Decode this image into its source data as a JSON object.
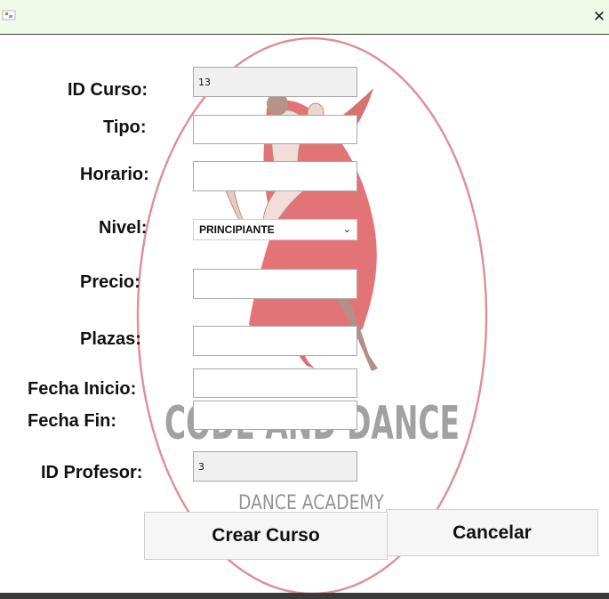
{
  "window": {
    "close_glyph": "✕"
  },
  "form": {
    "id_curso_label": "ID Curso:",
    "id_curso_value": "13",
    "tipo_label": "Tipo:",
    "tipo_value": "",
    "horario_label": "Horario:",
    "horario_value": "",
    "nivel_label": "Nivel:",
    "nivel_value": "PRINCIPIANTE",
    "precio_label": "Precio:",
    "precio_value": "",
    "plazas_label": "Plazas:",
    "plazas_value": "",
    "fecha_inicio_label": "Fecha Inicio:",
    "fecha_inicio_value": "",
    "fecha_fin_label": "Fecha Fin:",
    "fecha_fin_value": "",
    "id_profesor_label": "ID Profesor:",
    "id_profesor_value": "3"
  },
  "buttons": {
    "crear_label": "Crear Curso",
    "cancelar_label": "Cancelar"
  },
  "logo": {
    "name": "CODE AND DANCE",
    "tagline": "DANCE ACADEMY"
  },
  "colors": {
    "titlebar": "#eefbe8",
    "logo_ring": "#d9868c",
    "dancer_red": "#d9464a",
    "logo_text": "#8a8a8a"
  },
  "icons": {
    "chevron": "chevron-down-icon",
    "close": "close-icon"
  }
}
